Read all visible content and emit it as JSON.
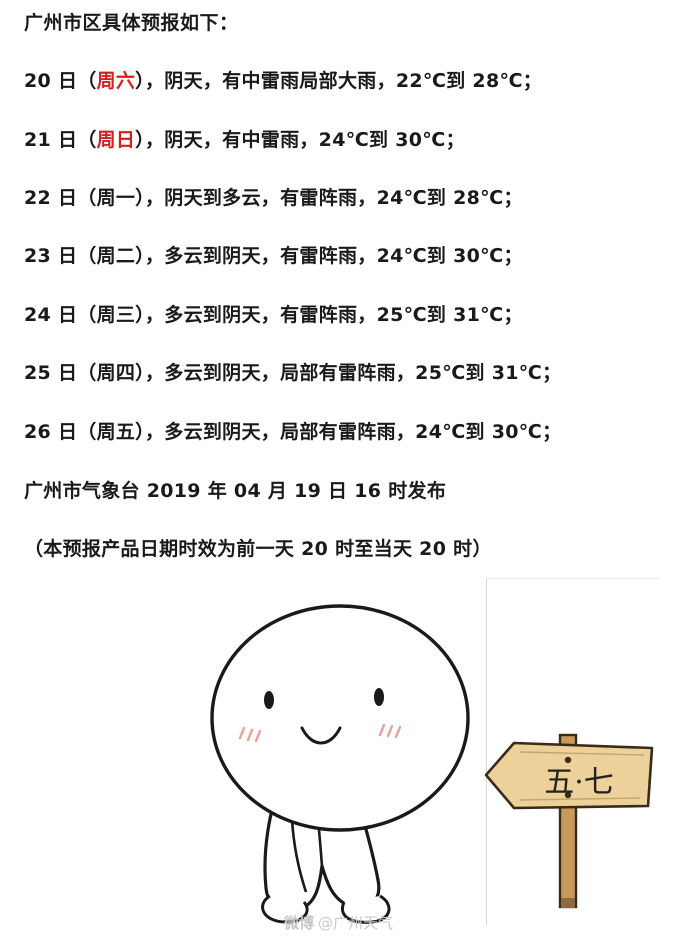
{
  "heading": "广州市区具体预报如下：",
  "forecast": [
    {
      "pre": "20 日（",
      "weekday": "周六",
      "weekday_red": true,
      "post": "），阴天，有中雷雨局部大雨，22℃到 28℃；"
    },
    {
      "pre": "21 日（",
      "weekday": "周日",
      "weekday_red": true,
      "post": "），阴天，有中雷雨，24℃到 30℃；"
    },
    {
      "pre": "22 日（",
      "weekday": "周一",
      "weekday_red": false,
      "post": "），阴天到多云，有雷阵雨，24℃到 28℃；"
    },
    {
      "pre": "23 日（",
      "weekday": "周二",
      "weekday_red": false,
      "post": "），多云到阴天，有雷阵雨，24℃到 30℃；"
    },
    {
      "pre": "24 日（",
      "weekday": "周三",
      "weekday_red": false,
      "post": "），多云到阴天，有雷阵雨，25℃到 31℃；"
    },
    {
      "pre": "25 日（",
      "weekday": "周四",
      "weekday_red": false,
      "post": "），多云到阴天，局部有雷阵雨，25℃到 31℃；"
    },
    {
      "pre": "26 日（",
      "weekday": "周五",
      "weekday_red": false,
      "post": "），多云到阴天，局部有雷阵雨，24℃到 30℃；"
    }
  ],
  "issued": "广州市气象台  2019 年 04 月 19 日 16 时发布",
  "validity_note": "（本预报产品日期时效为前一天 20 时至当天 20 时）",
  "sign_text": "五·七",
  "watermark": {
    "logo": "微博",
    "text": "@广州天气"
  },
  "colors": {
    "weekend": "#d4201c",
    "text": "#1a1a1a"
  }
}
